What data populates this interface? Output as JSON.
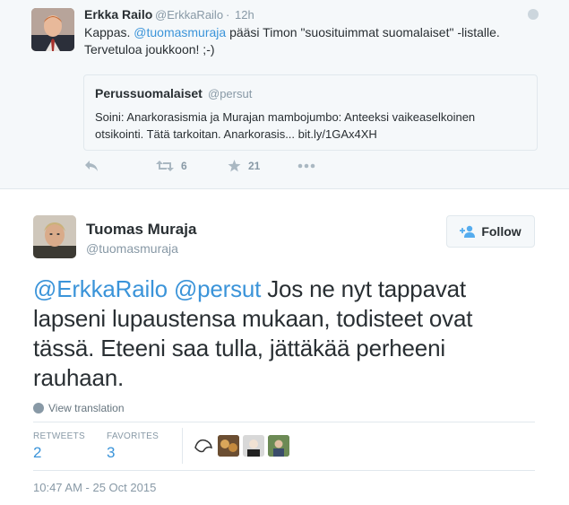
{
  "parent_tweet": {
    "name": "Erkka Railo",
    "handle": "@ErkkaRailo",
    "separator": "·",
    "time": "12h",
    "text_prefix": "Kappas. ",
    "mention": "@tuomasmuraja",
    "text_suffix": " pääsi Timon \"suosituimmat suomalaiset\" -listalle. Tervetuloa joukkoon! ;-)",
    "quote": {
      "name": "Perussuomalaiset",
      "handle": "@persut",
      "text": "Soini: Anarkorasismia ja Murajan mambojumbo: Anteeksi  vaikeaselkoinen otsikointi. Tätä tarkoitan. Anarkorasis... bit.ly/1GAx4XH"
    },
    "retweet_count": "6",
    "favorite_count": "21",
    "icons": [
      "reply-icon",
      "retweet-icon",
      "favorite-icon",
      "more-icon",
      "globe-icon"
    ]
  },
  "main_tweet": {
    "name": "Tuomas Muraja",
    "handle": "@tuomasmuraja",
    "follow_label": "Follow",
    "mention1": "@ErkkaRailo",
    "mention2": "@persut",
    "text": " Jos ne nyt tappavat lapseni lupaustensa mukaan, todisteet ovat tässä. Eteeni saa tulla, jättäkää perheeni rauhaan.",
    "view_translation": "View translation",
    "retweets_label": "RETWEETS",
    "retweets_value": "2",
    "favorites_label": "FAVORITES",
    "favorites_value": "3",
    "timestamp": "10:47 AM - 25 Oct 2015"
  },
  "colors": {
    "link": "#3b94d9",
    "muted": "#8899a6",
    "text": "#292f33",
    "parent_bg": "#f5f8fa",
    "border": "#e1e8ed"
  }
}
